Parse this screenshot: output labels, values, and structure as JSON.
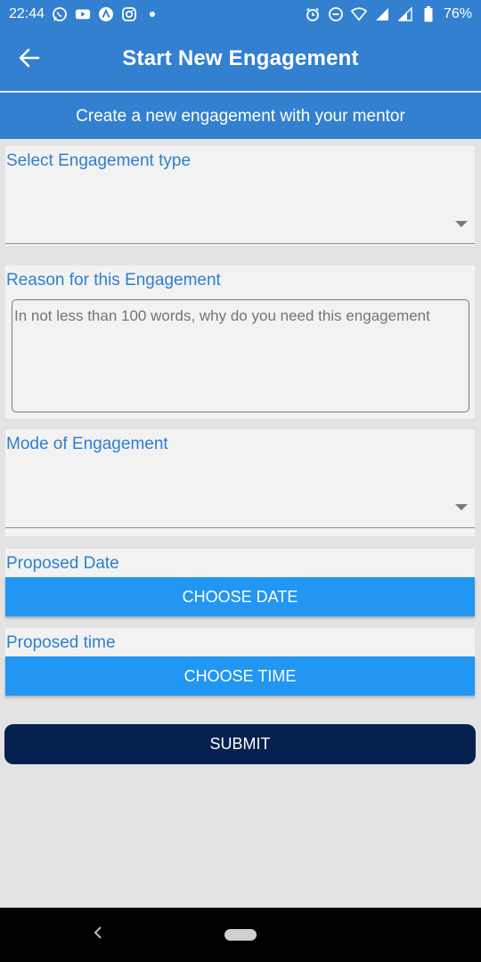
{
  "status_bar": {
    "time": "22:44",
    "battery": "76%",
    "left_icons": [
      "whatsapp-icon",
      "youtube-icon",
      "app-icon",
      "instagram-icon",
      "dot-icon"
    ],
    "right_icons": [
      "alarm-icon",
      "dnd-icon",
      "wifi-icon",
      "signal-icon",
      "signal-icon",
      "battery-icon"
    ]
  },
  "app_bar": {
    "title": "Start New Engagement",
    "back_icon": "arrow-left-icon"
  },
  "subheader": "Create a new engagement with your mentor",
  "form": {
    "engagement_type": {
      "label": "Select Engagement type",
      "value": ""
    },
    "reason": {
      "label": "Reason for this Engagement",
      "placeholder": "In not less than 100 words, why do you need this engagement"
    },
    "mode": {
      "label": "Mode of Engagement",
      "value": ""
    },
    "date": {
      "label": "Proposed Date",
      "button": "CHOOSE DATE"
    },
    "time": {
      "label": "Proposed time",
      "button": "CHOOSE TIME"
    },
    "submit": "SUBMIT"
  },
  "colors": {
    "primary": "#3380d0",
    "label": "#2f7fd0",
    "button": "#2196f3",
    "submit": "#062050"
  }
}
